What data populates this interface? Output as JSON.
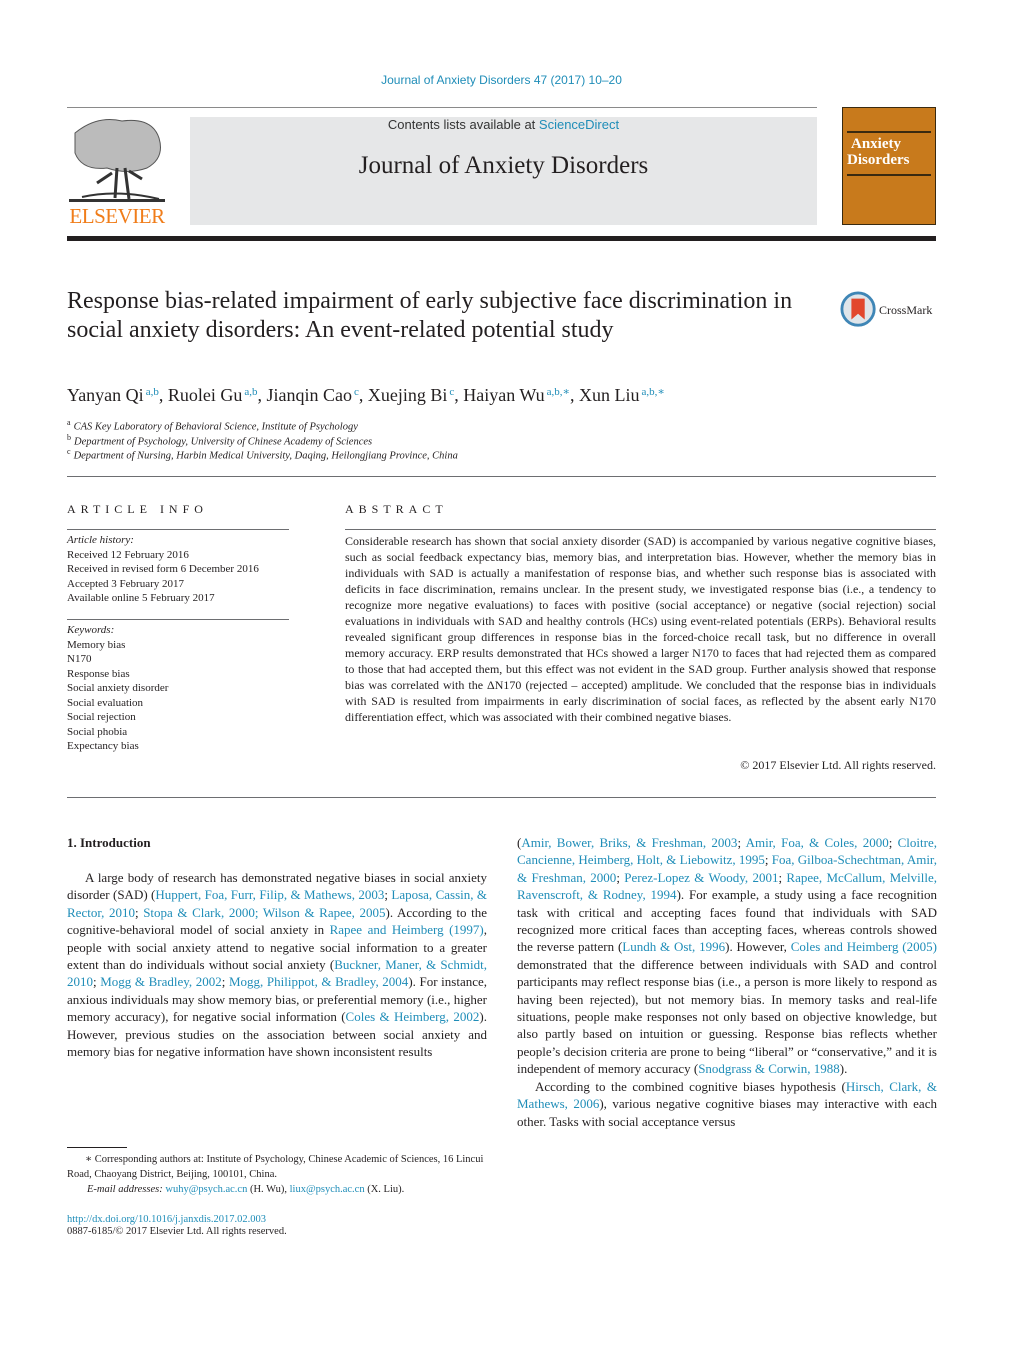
{
  "header": {
    "citation": "Journal of Anxiety Disorders 47 (2017) 10–20",
    "contents_prefix": "Contents lists available at ",
    "contents_link": "ScienceDirect",
    "journal_title": "Journal of Anxiety Disorders",
    "publisher_logo_text": "ELSEVIER",
    "cover_title_line1": "Anxiety",
    "cover_title_line2": "Disorders",
    "crossmark_label": "CrossMark",
    "colors": {
      "link": "#1f8db8",
      "elsevier_orange": "#f07d1a",
      "cover_orange": "#c87a1c",
      "banner_gray": "#e6e7e8"
    }
  },
  "article": {
    "title": "Response bias-related impairment of early subjective face discrimination in social anxiety disorders: An event-related potential study",
    "authors": [
      {
        "name": "Yanyan Qi",
        "sup": "a,b"
      },
      {
        "name": "Ruolei Gu",
        "sup": "a,b"
      },
      {
        "name": "Jianqin Cao",
        "sup": "c"
      },
      {
        "name": "Xuejing Bi",
        "sup": "c"
      },
      {
        "name": "Haiyan Wu",
        "sup": "a,b,∗"
      },
      {
        "name": "Xun Liu",
        "sup": "a,b,∗"
      }
    ],
    "affiliations": [
      {
        "key": "a",
        "text": "CAS Key Laboratory of Behavioral Science, Institute of Psychology"
      },
      {
        "key": "b",
        "text": "Department of Psychology, University of Chinese Academy of Sciences"
      },
      {
        "key": "c",
        "text": "Department of Nursing, Harbin Medical University, Daqing, Heilongjiang Province, China"
      }
    ]
  },
  "article_info": {
    "heading": "ARTICLE INFO",
    "history_label": "Article history:",
    "history": [
      "Received 12 February 2016",
      "Received in revised form 6 December 2016",
      "Accepted 3 February 2017",
      "Available online 5 February 2017"
    ],
    "keywords_label": "Keywords:",
    "keywords": [
      "Memory bias",
      "N170",
      "Response bias",
      "Social anxiety disorder",
      "Social evaluation",
      "Social rejection",
      "Social phobia",
      "Expectancy bias"
    ]
  },
  "abstract": {
    "heading": "ABSTRACT",
    "text": "Considerable research has shown that social anxiety disorder (SAD) is accompanied by various negative cognitive biases, such as social feedback expectancy bias, memory bias, and interpretation bias. However, whether the memory bias in individuals with SAD is actually a manifestation of response bias, and whether such response bias is associated with deficits in face discrimination, remains unclear. In the present study, we investigated response bias (i.e., a tendency to recognize more negative evaluations) to faces with positive (social acceptance) or negative (social rejection) social evaluations in individuals with SAD and healthy controls (HCs) using event-related potentials (ERPs). Behavioral results revealed significant group differences in response bias in the forced-choice recall task, but no difference in overall memory accuracy. ERP results demonstrated that HCs showed a larger N170 to faces that had rejected them as compared to those that had accepted them, but this effect was not evident in the SAD group. Further analysis showed that response bias was correlated with the ΔN170 (rejected – accepted) amplitude. We concluded that the response bias in individuals with SAD is resulted from impairments in early discrimination of social faces, as reflected by the absent early N170 differentiation effect, which was associated with their combined negative biases.",
    "copyright": "© 2017 Elsevier Ltd. All rights reserved."
  },
  "body": {
    "section_heading": "1.  Introduction",
    "col1": [
      {
        "t": "A large body of research has demonstrated negative biases in social anxiety disorder (SAD) ("
      },
      {
        "l": "Huppert, Foa, Furr, Filip, & Mathews, 2003"
      },
      {
        "t": "; "
      },
      {
        "l": "Laposa, Cassin, & Rector, 2010"
      },
      {
        "t": "; "
      },
      {
        "l": "Stopa & Clark, 2000; Wilson & Rapee, 2005"
      },
      {
        "t": "). According to the cognitive-behavioral model of social anxiety in "
      },
      {
        "l": "Rapee and Heimberg (1997)"
      },
      {
        "t": ", people with social anxiety attend to negative social information to a greater extent than do individuals without social anxiety ("
      },
      {
        "l": "Buckner, Maner, & Schmidt, 2010"
      },
      {
        "t": "; "
      },
      {
        "l": "Mogg & Bradley, 2002"
      },
      {
        "t": "; "
      },
      {
        "l": "Mogg, Philippot, & Bradley, 2004"
      },
      {
        "t": "). For instance, anxious individuals may show memory bias, or preferential memory (i.e., higher memory accuracy), for negative social information ("
      },
      {
        "l": "Coles & Heimberg, 2002"
      },
      {
        "t": "). However, previous studies on the association between social anxiety and memory bias for negative information have shown inconsistent results"
      }
    ],
    "col2_p1": [
      {
        "t": "("
      },
      {
        "l": "Amir, Bower, Briks, & Freshman, 2003"
      },
      {
        "t": "; "
      },
      {
        "l": "Amir, Foa, & Coles, 2000"
      },
      {
        "t": "; "
      },
      {
        "l": "Cloitre, Cancienne, Heimberg, Holt, & Liebowitz, 1995"
      },
      {
        "t": "; "
      },
      {
        "l": "Foa, Gilboa-Schechtman, Amir, & Freshman, 2000"
      },
      {
        "t": "; "
      },
      {
        "l": "Perez-Lopez & Woody, 2001"
      },
      {
        "t": "; "
      },
      {
        "l": "Rapee, McCallum, Melville, Ravenscroft, & Rodney, 1994"
      },
      {
        "t": "). For example, a study using a face recognition task with critical and accepting faces found that individuals with SAD recognized more critical faces than accepting faces, whereas controls showed the reverse pattern ("
      },
      {
        "l": "Lundh & Ost, 1996"
      },
      {
        "t": "). However, "
      },
      {
        "l": "Coles and Heimberg (2005)"
      },
      {
        "t": " demonstrated that the difference between individuals with SAD and control participants may reflect response bias (i.e., a person is more likely to respond as having been rejected), but not memory bias. In memory tasks and real-life situations, people make responses not only based on objective knowledge, but also partly based on intuition or guessing. Response bias reflects whether people’s decision criteria are prone to being “liberal” or “conservative,” and it is independent of memory accuracy ("
      },
      {
        "l": "Snodgrass & Corwin, 1988"
      },
      {
        "t": ")."
      }
    ],
    "col2_p2": [
      {
        "t": "According to the combined cognitive biases hypothesis ("
      },
      {
        "l": "Hirsch, Clark, & Mathews, 2006"
      },
      {
        "t": "), various negative cognitive biases may interactive with each other. Tasks with social acceptance versus"
      }
    ]
  },
  "footnote": {
    "corresponding": "∗ Corresponding authors at: Institute of Psychology, Chinese Academic of Sciences, 16 Lincui Road, Chaoyang District, Beijing, 100101, China.",
    "email_label": "E-mail addresses:",
    "email1": "wuhy@psych.ac.cn",
    "email1_name": " (H. Wu), ",
    "email2": "liux@psych.ac.cn",
    "email2_name": " (X. Liu).",
    "doi": "http://dx.doi.org/10.1016/j.janxdis.2017.02.003",
    "issn": "0887-6185/© 2017 Elsevier Ltd. All rights reserved."
  }
}
